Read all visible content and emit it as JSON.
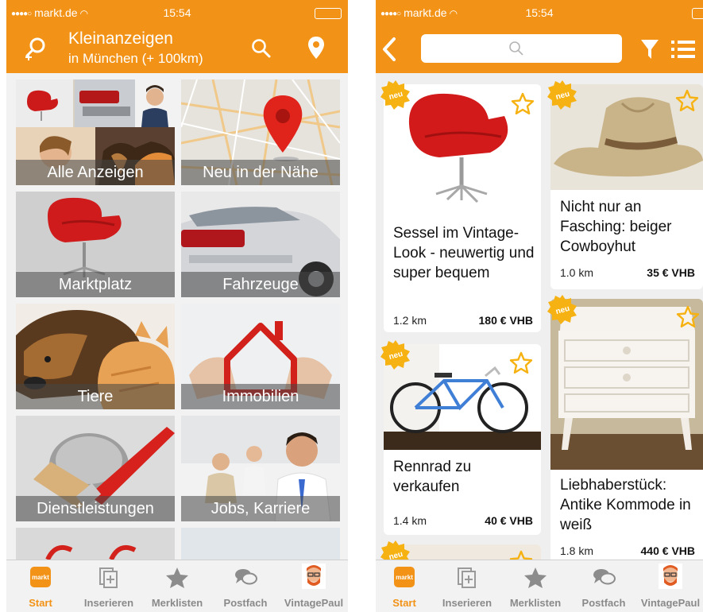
{
  "status_bar": {
    "carrier": "markt.de",
    "time": "15:54"
  },
  "left_screen": {
    "nav": {
      "title": "Kleinanzeigen",
      "subtitle": "in München (+ 100km)"
    },
    "categories": [
      {
        "label": "Alle Anzeigen"
      },
      {
        "label": "Neu in der Nähe"
      },
      {
        "label": "Marktplatz"
      },
      {
        "label": "Fahrzeuge"
      },
      {
        "label": "Tiere"
      },
      {
        "label": "Immobilien"
      },
      {
        "label": "Dienstleistungen"
      },
      {
        "label": "Jobs, Karriere"
      }
    ]
  },
  "right_screen": {
    "search": {
      "placeholder": ""
    },
    "listings": [
      {
        "badge": "neu",
        "title": "Sessel im Vintage-Look - neuwertig und super bequem",
        "distance": "1.2 km",
        "price": "180 € VHB"
      },
      {
        "badge": "neu",
        "title": "Nicht nur an Fasching: beiger Cowboyhut",
        "distance": "1.0 km",
        "price": "35 € VHB"
      },
      {
        "badge": "neu",
        "title": "Rennrad zu verkaufen",
        "distance": "1.4 km",
        "price": "40 € VHB"
      },
      {
        "badge": "neu",
        "title": "Liebhaberstück: Antike Kommode in weiß",
        "distance": "1.8 km",
        "price": "440 € VHB"
      },
      {
        "badge": "neu"
      }
    ]
  },
  "tab_bar": {
    "tabs": [
      {
        "label": "Start",
        "icon": "markt-logo-icon",
        "active": true
      },
      {
        "label": "Inserieren",
        "icon": "add-listing-icon"
      },
      {
        "label": "Merklisten",
        "icon": "star-icon"
      },
      {
        "label": "Postfach",
        "icon": "chat-bubbles-icon"
      },
      {
        "label": "VintagePaul",
        "icon": "avatar-icon"
      }
    ]
  },
  "colors": {
    "brand_orange": "#f29317",
    "active_tab": "#f29317",
    "inactive_tab": "#8a8a8a",
    "badge_yellow": "#f6b213",
    "chair_red": "#d21a1a"
  }
}
